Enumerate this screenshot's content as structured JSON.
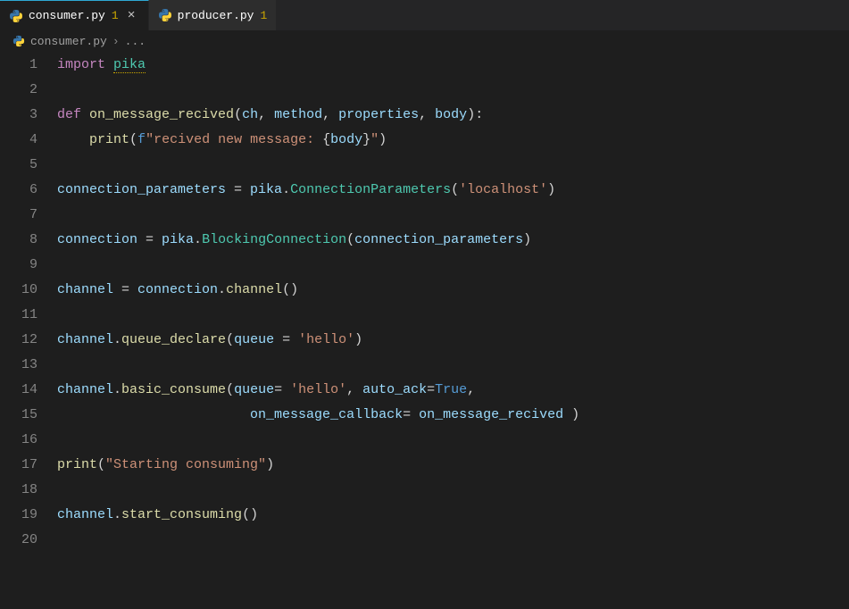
{
  "tabs": [
    {
      "name": "consumer.py",
      "modified": "1",
      "active": true
    },
    {
      "name": "producer.py",
      "modified": "1",
      "active": false
    }
  ],
  "breadcrumb": {
    "file": "consumer.py",
    "rest": "..."
  },
  "code": {
    "lines": [
      {
        "n": "1",
        "tokens": [
          [
            "kw",
            "import"
          ],
          [
            "pun",
            " "
          ],
          [
            "mod1",
            "pika"
          ]
        ]
      },
      {
        "n": "2",
        "tokens": []
      },
      {
        "n": "3",
        "tokens": [
          [
            "kw",
            "def"
          ],
          [
            "pun",
            " "
          ],
          [
            "fn",
            "on_message_recived"
          ],
          [
            "pun",
            "("
          ],
          [
            "pm",
            "ch"
          ],
          [
            "pun",
            ", "
          ],
          [
            "pm",
            "method"
          ],
          [
            "pun",
            ", "
          ],
          [
            "pm",
            "properties"
          ],
          [
            "pun",
            ", "
          ],
          [
            "pm",
            "body"
          ],
          [
            "pun",
            "):"
          ]
        ]
      },
      {
        "n": "4",
        "tokens": [
          [
            "guide",
            "    "
          ],
          [
            "call",
            "print"
          ],
          [
            "pun",
            "("
          ],
          [
            "fpre",
            "f"
          ],
          [
            "str",
            "\"recived new message: "
          ],
          [
            "pun",
            "{"
          ],
          [
            "var",
            "body"
          ],
          [
            "pun",
            "}"
          ],
          [
            "str",
            "\""
          ],
          [
            "pun",
            ")"
          ]
        ]
      },
      {
        "n": "5",
        "tokens": []
      },
      {
        "n": "6",
        "tokens": [
          [
            "var",
            "connection_parameters"
          ],
          [
            "op",
            " = "
          ],
          [
            "var",
            "pika"
          ],
          [
            "pun",
            "."
          ],
          [
            "cls",
            "ConnectionParameters"
          ],
          [
            "pun",
            "("
          ],
          [
            "str",
            "'localhost'"
          ],
          [
            "pun",
            ")"
          ]
        ]
      },
      {
        "n": "7",
        "tokens": []
      },
      {
        "n": "8",
        "tokens": [
          [
            "var",
            "connection"
          ],
          [
            "op",
            " = "
          ],
          [
            "var",
            "pika"
          ],
          [
            "pun",
            "."
          ],
          [
            "cls",
            "BlockingConnection"
          ],
          [
            "pun",
            "("
          ],
          [
            "var",
            "connection_parameters"
          ],
          [
            "pun",
            ")"
          ]
        ]
      },
      {
        "n": "9",
        "tokens": []
      },
      {
        "n": "10",
        "tokens": [
          [
            "var",
            "channel"
          ],
          [
            "op",
            " = "
          ],
          [
            "var",
            "connection"
          ],
          [
            "pun",
            "."
          ],
          [
            "call",
            "channel"
          ],
          [
            "pun",
            "()"
          ]
        ]
      },
      {
        "n": "11",
        "tokens": []
      },
      {
        "n": "12",
        "tokens": [
          [
            "var",
            "channel"
          ],
          [
            "pun",
            "."
          ],
          [
            "call",
            "queue_declare"
          ],
          [
            "pun",
            "("
          ],
          [
            "pm",
            "queue"
          ],
          [
            "op",
            " = "
          ],
          [
            "str",
            "'hello'"
          ],
          [
            "pun",
            ")"
          ]
        ]
      },
      {
        "n": "13",
        "tokens": []
      },
      {
        "n": "14",
        "tokens": [
          [
            "var",
            "channel"
          ],
          [
            "pun",
            "."
          ],
          [
            "call",
            "basic_consume"
          ],
          [
            "pun",
            "("
          ],
          [
            "pm",
            "queue"
          ],
          [
            "op",
            "= "
          ],
          [
            "str",
            "'hello'"
          ],
          [
            "pun",
            ", "
          ],
          [
            "pm",
            "auto_ack"
          ],
          [
            "op",
            "="
          ],
          [
            "const",
            "True"
          ],
          [
            "pun",
            ","
          ]
        ]
      },
      {
        "n": "15",
        "tokens": [
          [
            "guide",
            "                        "
          ],
          [
            "pm",
            "on_message_callback"
          ],
          [
            "op",
            "= "
          ],
          [
            "var",
            "on_message_recived"
          ],
          [
            "pun",
            " )"
          ]
        ]
      },
      {
        "n": "16",
        "tokens": []
      },
      {
        "n": "17",
        "tokens": [
          [
            "call",
            "print"
          ],
          [
            "pun",
            "("
          ],
          [
            "str",
            "\"Starting consuming\""
          ],
          [
            "pun",
            ")"
          ]
        ]
      },
      {
        "n": "18",
        "tokens": []
      },
      {
        "n": "19",
        "tokens": [
          [
            "var",
            "channel"
          ],
          [
            "pun",
            "."
          ],
          [
            "call",
            "start_consuming"
          ],
          [
            "pun",
            "()"
          ]
        ]
      },
      {
        "n": "20",
        "tokens": []
      }
    ]
  }
}
